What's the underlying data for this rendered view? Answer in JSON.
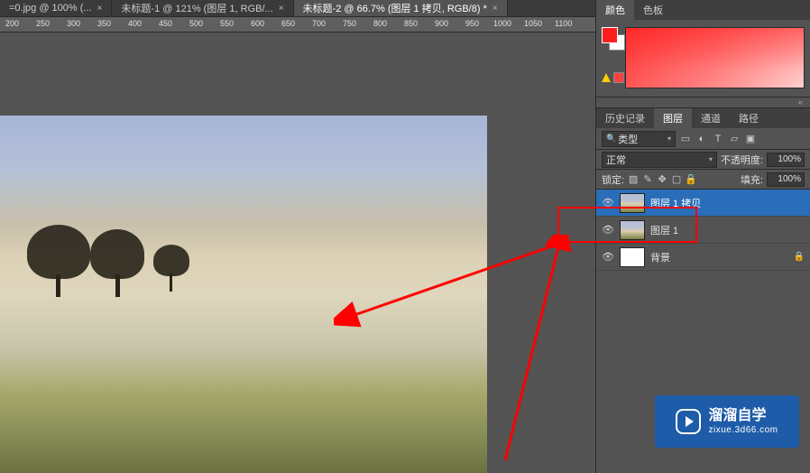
{
  "tabs": [
    {
      "label": "=0.jpg @ 100% (...",
      "close": "×"
    },
    {
      "label": "未标题-1 @ 121% (图层 1, RGB/...",
      "close": "×"
    },
    {
      "label": "未标题-2 @ 66.7% (图层 1 拷贝, RGB/8) *",
      "close": "×"
    }
  ],
  "ruler": [
    {
      "v": "200"
    },
    {
      "v": "250"
    },
    {
      "v": "300"
    },
    {
      "v": "350"
    },
    {
      "v": "400"
    },
    {
      "v": "450"
    },
    {
      "v": "500"
    },
    {
      "v": "550"
    },
    {
      "v": "600"
    },
    {
      "v": "650"
    },
    {
      "v": "700"
    },
    {
      "v": "750"
    },
    {
      "v": "800"
    },
    {
      "v": "850"
    },
    {
      "v": "900"
    },
    {
      "v": "950"
    },
    {
      "v": "1000"
    },
    {
      "v": "1050"
    },
    {
      "v": "1100"
    }
  ],
  "color_panel": {
    "tabs": {
      "color": "颜色",
      "swatches": "色板"
    }
  },
  "collapse": "«",
  "layers_panel": {
    "tabs": {
      "history": "历史记录",
      "layers": "图层",
      "channels": "通道",
      "paths": "路径"
    },
    "kind_search_icon": "🔍",
    "kind": "类型",
    "blend_mode": "正常",
    "opacity_label": "不透明度:",
    "opacity_value": "100%",
    "lock_label": "锁定:",
    "fill_label": "填充:",
    "fill_value": "100%",
    "layers": [
      {
        "name": "图层 1 拷贝",
        "selected": true,
        "locked": false
      },
      {
        "name": "图层 1",
        "selected": false,
        "locked": false
      },
      {
        "name": "背景",
        "selected": false,
        "locked": true
      }
    ]
  },
  "watermark": {
    "title": "溜溜自学",
    "url": "zixue.3d66.com"
  }
}
